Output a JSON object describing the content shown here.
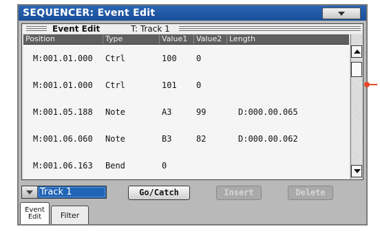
{
  "window": {
    "title": "SEQUENCER: Event Edit"
  },
  "panel": {
    "title": "Event Edit",
    "track_label": "T: Track 1"
  },
  "columns": [
    "Position",
    "Type",
    "Value1",
    "Value2",
    "Length"
  ],
  "rows": [
    {
      "position": "M:001.01.000",
      "type": "Ctrl",
      "value1": "100",
      "value2": "0",
      "length": ""
    },
    {
      "position": "M:001.01.000",
      "type": "Ctrl",
      "value1": "101",
      "value2": "0",
      "length": ""
    },
    {
      "position": "M:001.05.188",
      "type": "Note",
      "value1": "A3",
      "value2": "99",
      "length": "D:000.00.065"
    },
    {
      "position": "M:001.06.060",
      "type": "Note",
      "value1": "B3",
      "value2": "82",
      "length": "D:000.00.062"
    },
    {
      "position": "M:001.06.163",
      "type": "Bend",
      "value1": "0",
      "value2": "",
      "length": ""
    }
  ],
  "controls": {
    "track_select": "Track 1",
    "go_catch": "Go/Catch",
    "insert": "Insert",
    "delete": "Delete"
  },
  "tabs": [
    {
      "line1": "Event",
      "line2": "Edit",
      "selected": true
    },
    {
      "line1": "Filter",
      "line2": "",
      "selected": false
    }
  ],
  "colors": {
    "title_bar": "#1f5aa8",
    "selection": "#1f64b5",
    "pointer": "#e8462a"
  }
}
